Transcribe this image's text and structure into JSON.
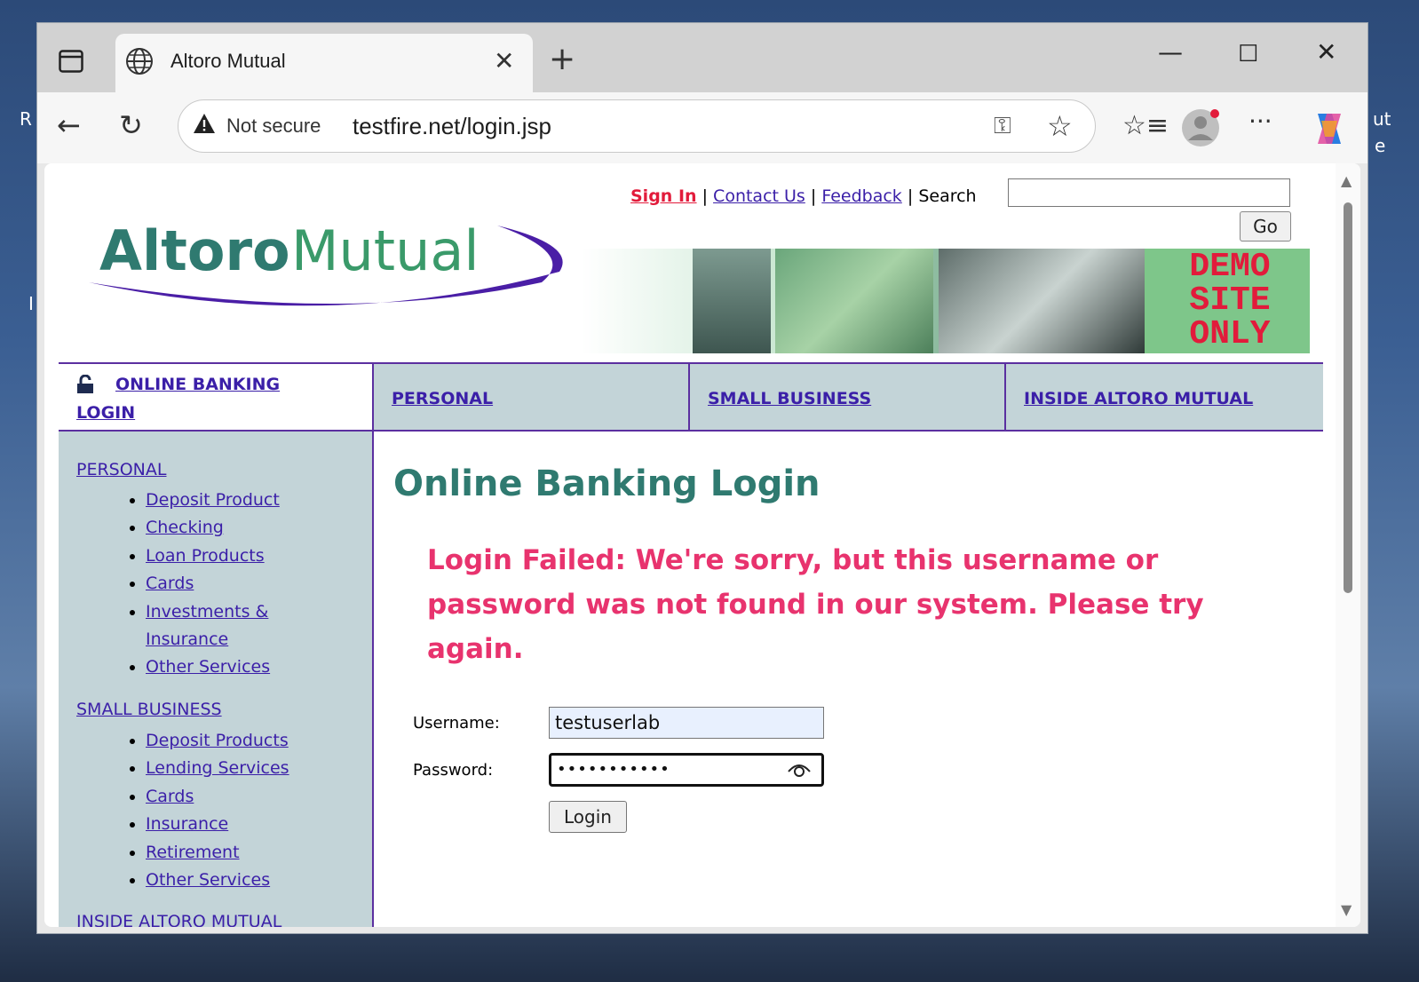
{
  "browser": {
    "tab_title": "Altoro Mutual",
    "security_label": "Not secure",
    "url": "testfire.net/login.jsp"
  },
  "desktop": {
    "left_text_top": "R",
    "left_text_mid": "I",
    "right_text_top": "ut",
    "right_text_mid": "e"
  },
  "header": {
    "sign_in": "Sign In",
    "contact_us": "Contact Us",
    "feedback": "Feedback",
    "separator": "|",
    "search_label": "Search",
    "search_value": "",
    "go_label": "Go",
    "logo_text_bold": "Altoro",
    "logo_text_light": "Mutual",
    "banner_text": [
      "DEMO",
      "SITE",
      "ONLY"
    ]
  },
  "nav": {
    "login_line1": "ONLINE BANKING",
    "login_line2": "LOGIN",
    "personal": "PERSONAL",
    "small_business": "SMALL BUSINESS",
    "inside": "INSIDE ALTORO MUTUAL"
  },
  "sidebar": {
    "personal_title": "PERSONAL",
    "personal_items": [
      "Deposit Product",
      "Checking",
      "Loan Products",
      "Cards",
      "Investments &",
      "Insurance",
      "Other Services"
    ],
    "business_title": "SMALL BUSINESS",
    "business_items": [
      "Deposit Products",
      "Lending Services",
      "Cards",
      "Insurance",
      "Retirement",
      "Other Services"
    ],
    "inside_title": "INSIDE ALTORO MUTUAL"
  },
  "login": {
    "heading": "Online Banking Login",
    "error": "Login Failed: We're sorry, but this username or password was not found in our system. Please try again.",
    "username_label": "Username:",
    "username_value": "testuserlab",
    "password_label": "Password:",
    "password_mask": "•••••••••••",
    "login_button": "Login"
  },
  "colors": {
    "accent_purple": "#3b1fa8",
    "error_pink": "#e8336e",
    "heading_teal": "#2f7a70",
    "nav_bg": "#c3d4d8"
  }
}
